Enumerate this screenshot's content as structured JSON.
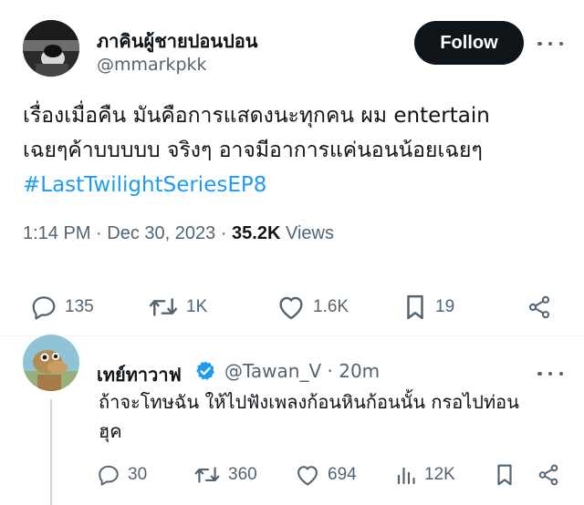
{
  "tweet": {
    "display_name": "ภาคินผู้ชายปอนปอน",
    "handle": "@mmarkpkk",
    "follow_label": "Follow",
    "text_lines": [
      "เรื่องเมื่อคืน มันคือการแสดงนะทุกคน ผม entertain",
      "เฉยๆค้าบบบบบ จริงๆ อาจมีอาการแค่นอนน้อยเฉยๆ"
    ],
    "hashtag": "#LastTwilightSeriesEP8",
    "time": "1:14 PM",
    "date": "Dec 30, 2023",
    "views_count": "35.2K",
    "views_label": "Views",
    "stats": {
      "replies": "135",
      "retweets": "1K",
      "likes": "1.6K",
      "bookmarks": "19"
    }
  },
  "reply": {
    "display_name": "เทย์ทาวาฟ",
    "handle": "@Tawan_V",
    "separator": "·",
    "time": "20m",
    "text_lines": [
      "ถ้าจะโทษฉัน ให้ไปฟังเพลงก้อนหินก้อนนั้น กรอไปท่อน",
      "ฮุค"
    ],
    "stats": {
      "replies": "30",
      "retweets": "360",
      "likes": "694",
      "views": "12K"
    }
  },
  "colors": {
    "text": "#0f1419",
    "secondary": "#536471",
    "link": "#1d9bf0",
    "verified": "#1d9bf0",
    "follow_bg": "#0f1419"
  }
}
